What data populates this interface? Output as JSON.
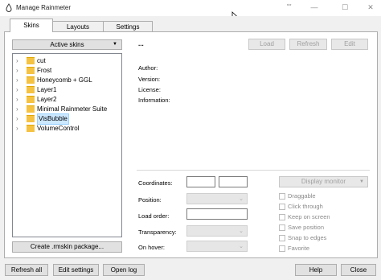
{
  "window": {
    "title": "Manage Rainmeter",
    "controls": {
      "minimize": "—",
      "maximize": "☐",
      "close": "✕"
    }
  },
  "tabs": [
    {
      "label": "Skins",
      "active": true
    },
    {
      "label": "Layouts",
      "active": false
    },
    {
      "label": "Settings",
      "active": false
    }
  ],
  "skins_panel": {
    "active_skins_label": "Active skins",
    "skins": [
      "cut",
      "Frost",
      "Honeycomb + GGL",
      "Layer1",
      "Layer2",
      "Minimal Rainmeter Suite",
      "VisBubble",
      "VolumeControl"
    ],
    "selected_skin": "VisBubble",
    "create_package_label": "Create .rmskin package..."
  },
  "skin_header": {
    "name": "...",
    "load_label": "Load",
    "refresh_label": "Refresh",
    "edit_label": "Edit"
  },
  "info": {
    "author_label": "Author:",
    "version_label": "Version:",
    "license_label": "License:",
    "information_label": "Information:"
  },
  "settings": {
    "coordinates_label": "Coordinates:",
    "position_label": "Position:",
    "load_order_label": "Load order:",
    "transparency_label": "Transparency:",
    "on_hover_label": "On hover:",
    "display_monitor_label": "Display monitor",
    "checkboxes": [
      "Draggable",
      "Click through",
      "Keep on screen",
      "Save position",
      "Snap to edges",
      "Favorite"
    ]
  },
  "footer": {
    "refresh_all_label": "Refresh all",
    "edit_settings_label": "Edit settings",
    "open_log_label": "Open log",
    "help_label": "Help",
    "close_label": "Close"
  },
  "colors": {
    "folder": "#f5c242",
    "selection_bg": "#cce8ff",
    "window_bg": "#f0f0f0"
  }
}
